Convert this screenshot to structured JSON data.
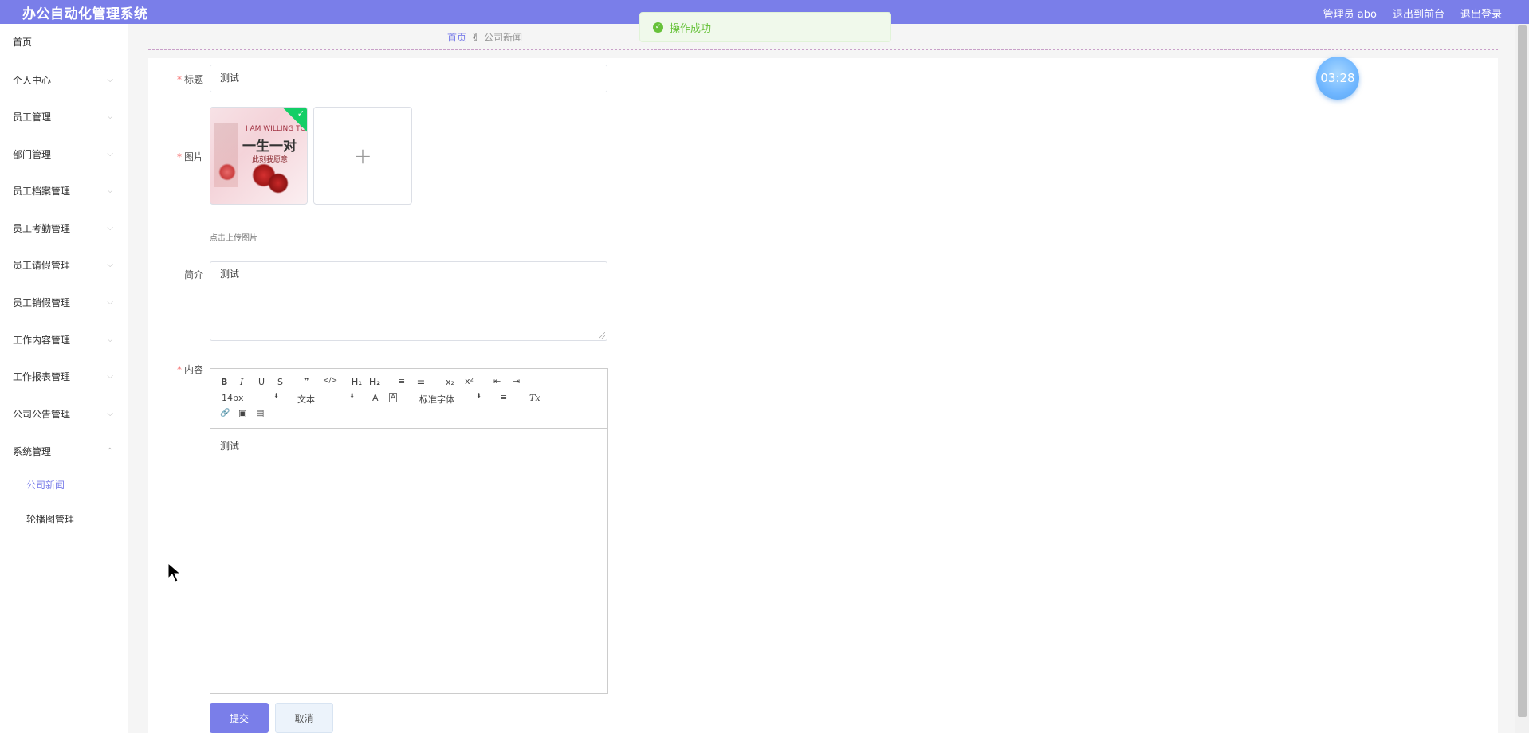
{
  "header": {
    "title": "办公自动化管理系统",
    "user": "管理员 abo",
    "to_front": "退出到前台",
    "logout": "退出登录"
  },
  "toast": {
    "message": "操作成功",
    "type": "success"
  },
  "breadcrumb": {
    "home": "首页",
    "separator_icon": "hand-icon",
    "current": "公司新闻"
  },
  "sidebar": {
    "items": [
      {
        "label": "首页"
      },
      {
        "label": "个人中心"
      },
      {
        "label": "员工管理"
      },
      {
        "label": "部门管理"
      },
      {
        "label": "员工档案管理"
      },
      {
        "label": "员工考勤管理"
      },
      {
        "label": "员工请假管理"
      },
      {
        "label": "员工销假管理"
      },
      {
        "label": "工作内容管理"
      },
      {
        "label": "工作报表管理"
      },
      {
        "label": "公司公告管理"
      },
      {
        "label": "系统管理"
      }
    ],
    "sub_items": [
      {
        "label": "公司新闻",
        "active": true
      },
      {
        "label": "轮播图管理",
        "active": false
      }
    ]
  },
  "form": {
    "title_label": "标题",
    "title_value": "测试",
    "image_label": "图片",
    "image_hint": "点击上传图片",
    "upload_plus": "+",
    "thumb_text_1": "I AM WILLING TO",
    "thumb_text_2": "一生一对",
    "thumb_text_3": "此刻我愿意",
    "summary_label": "简介",
    "summary_value": "测试",
    "content_label": "内容",
    "content_value": "测试",
    "submit": "提交",
    "cancel": "取消"
  },
  "editor_toolbar": {
    "bold": "B",
    "italic": "I",
    "underline": "U",
    "strike": "S",
    "quote": "❞",
    "code": "</>",
    "h1": "H₁",
    "h2": "H₂",
    "ordered_list": "≡",
    "bullet_list": "☰",
    "sub": "x₂",
    "sup": "x²",
    "outdent": "⇤",
    "indent": "⇥",
    "size": "14px",
    "header": "文本",
    "color": "A",
    "background": "A",
    "font": "标准字体",
    "align": "≡",
    "clean": "Tx",
    "link": "🔗",
    "image": "▣",
    "video": "▤"
  },
  "timer": {
    "value": "03:28"
  },
  "colors": {
    "accent": "#7a7ee9",
    "success": "#67c23a",
    "required": "#f56c6c"
  }
}
